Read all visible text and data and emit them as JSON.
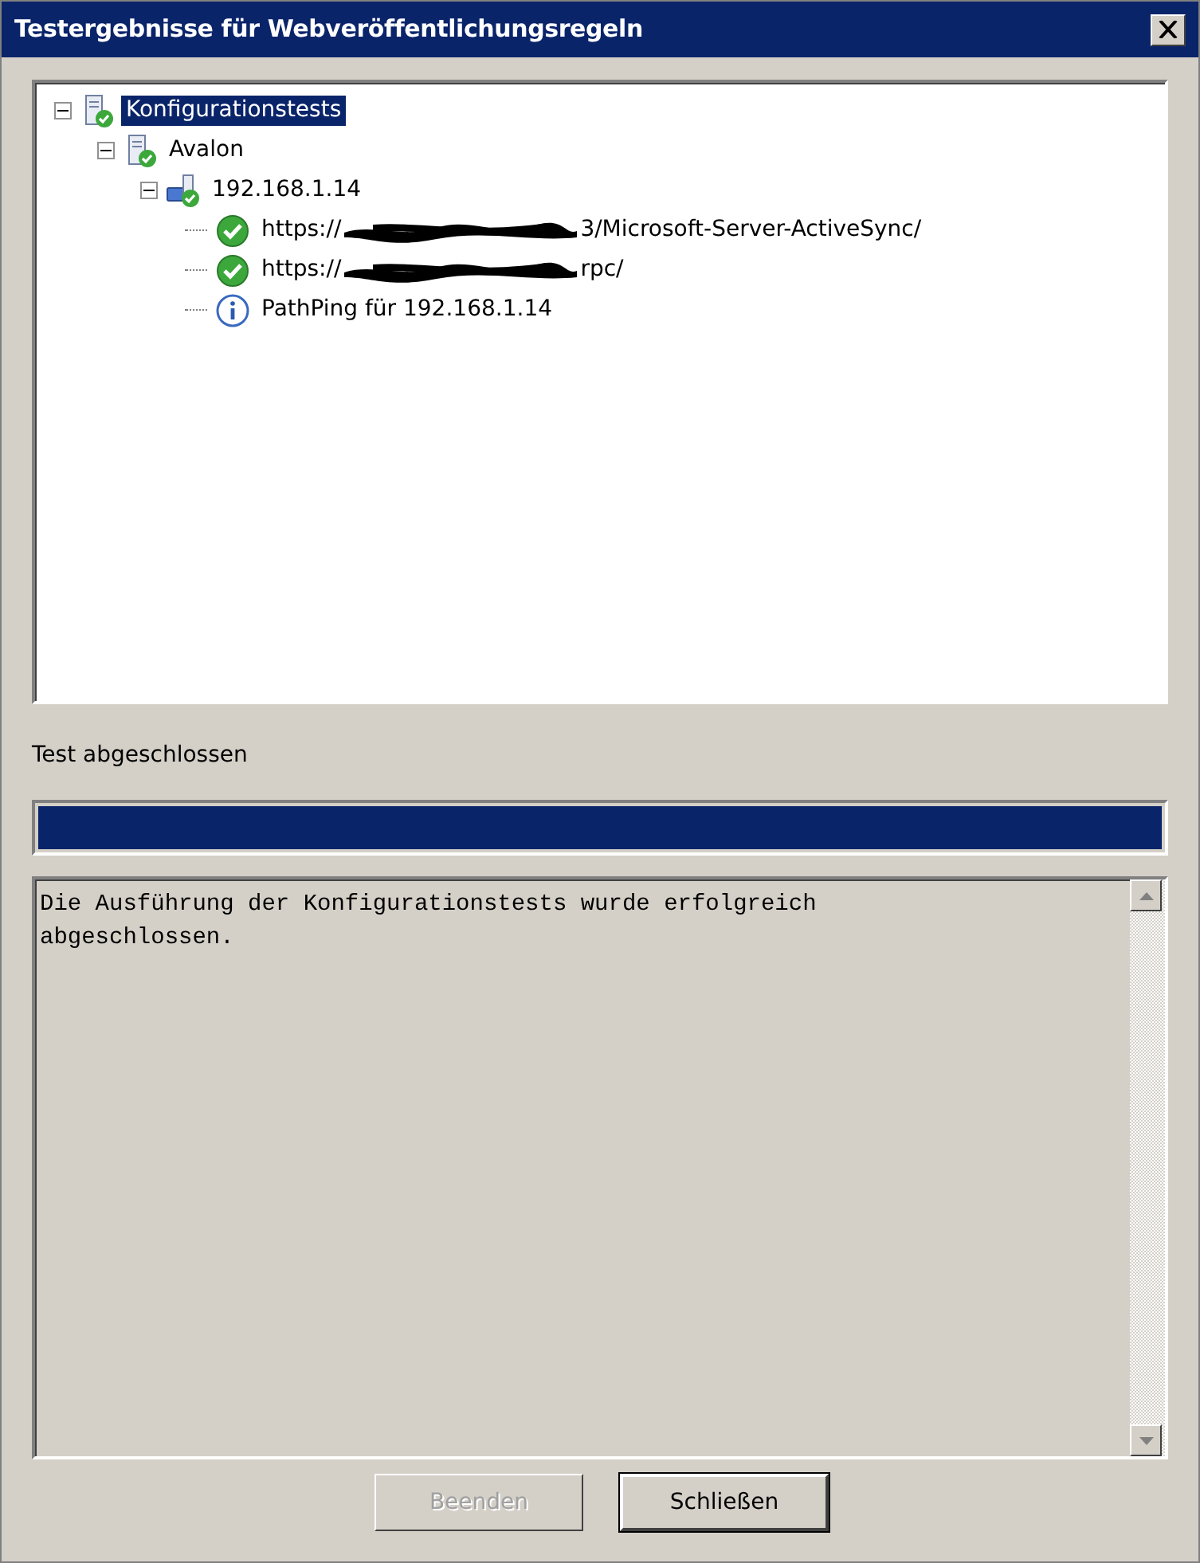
{
  "window": {
    "title": "Testergebnisse für Webveröffentlichungsregeln"
  },
  "tree": [
    {
      "kind": "config",
      "label": "Konfigurationstests",
      "selected": true,
      "expanded": true,
      "children": [
        {
          "kind": "server",
          "label": "Avalon",
          "selected": false,
          "expanded": true,
          "children": [
            {
              "kind": "ip",
              "label": "192.168.1.14",
              "selected": false,
              "expanded": true,
              "children": [
                {
                  "kind": "success",
                  "url_prefix": "https://",
                  "url_suffix": "3/Microsoft-Server-ActiveSync/",
                  "selected": false
                },
                {
                  "kind": "success",
                  "url_prefix": "https://",
                  "url_suffix": "rpc/",
                  "selected": false
                },
                {
                  "kind": "info",
                  "label": "PathPing für 192.168.1.14",
                  "selected": false
                }
              ]
            }
          ]
        }
      ]
    }
  ],
  "status": "Test abgeschlossen",
  "progress": {
    "level": 1
  },
  "log": "Die Ausführung der Konfigurationstests wurde erfolgreich\nabgeschlossen.",
  "buttons": [
    {
      "label": "Beenden",
      "disabled": true,
      "default": false
    },
    {
      "label": "Schließen",
      "disabled": false,
      "default": true
    }
  ]
}
